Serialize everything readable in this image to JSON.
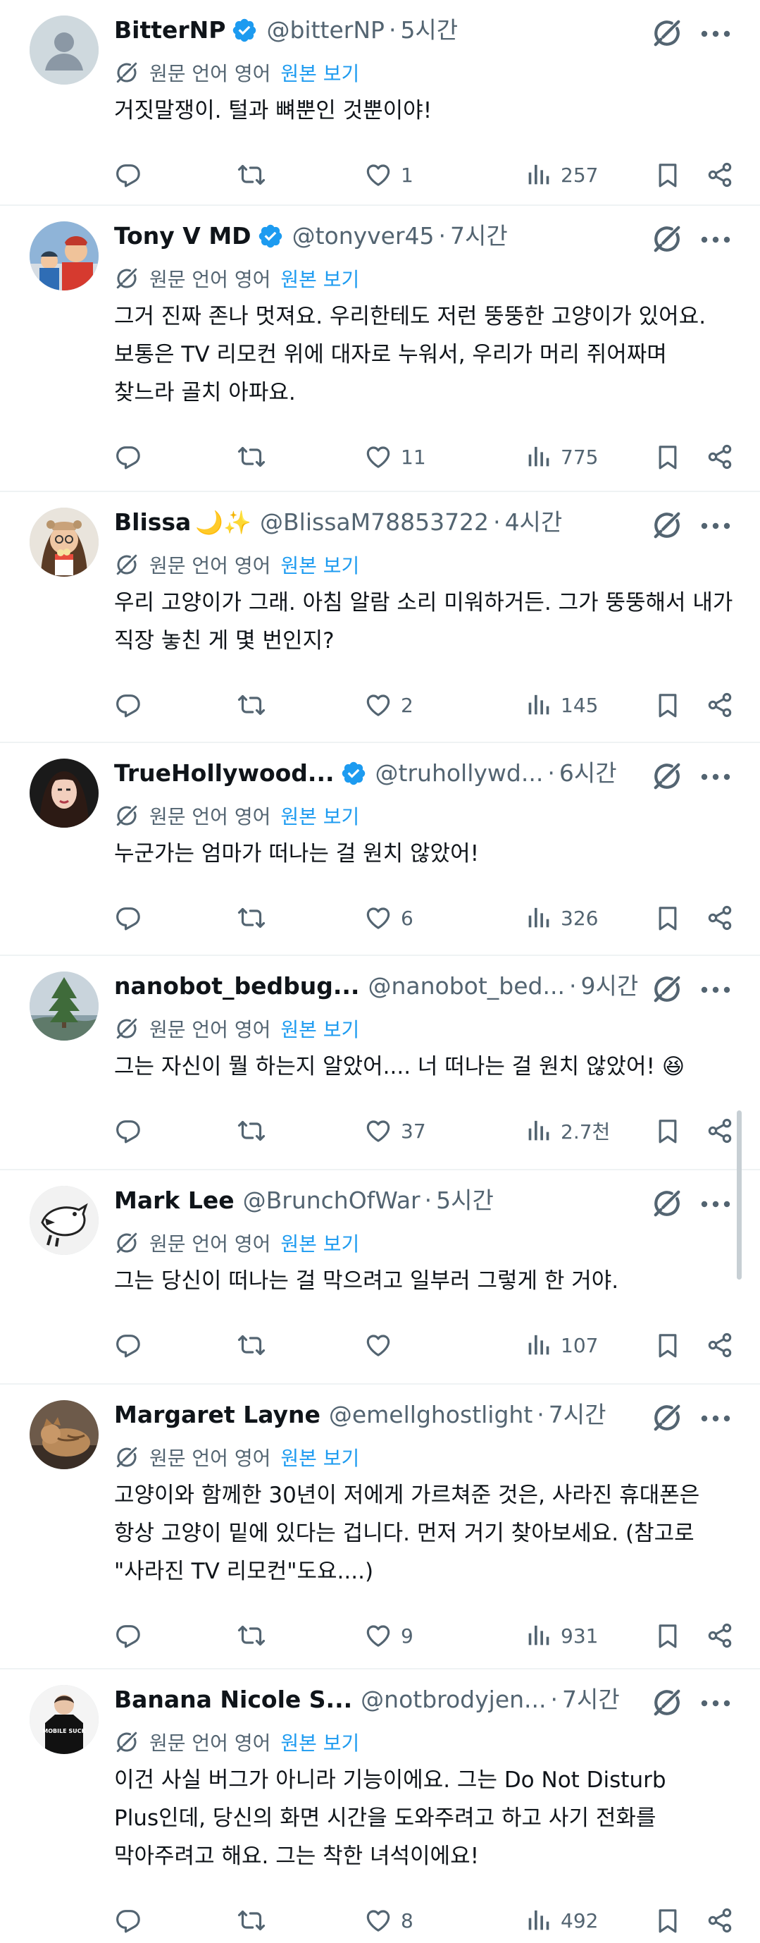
{
  "translate": {
    "label": "원문 언어 영어",
    "link": "원본 보기"
  },
  "separator": "·",
  "colors": {
    "accent": "#1d9bf0",
    "secondary": "#536471",
    "text": "#0f1419"
  },
  "tweets": [
    {
      "name": "BitterNP",
      "emoji": "",
      "verified": true,
      "handle": "@bitterNP",
      "time": "5시간",
      "text": "거짓말쟁이. 털과 뼈뿐인 것뿐이야!",
      "replies": "",
      "reposts": "",
      "likes": "1",
      "views": "257",
      "avatar": "default-avatar"
    },
    {
      "name": "Tony V MD",
      "emoji": "",
      "verified": true,
      "handle": "@tonyver45",
      "time": "7시간",
      "text": "그거 진짜 존나 멋져요. 우리한테도 저런 뚱뚱한 고양이가 있어요. 보통은 TV 리모컨 위에 대자로 누워서, 우리가 머리 쥐어짜며 찾느라 골치 아파요.",
      "replies": "",
      "reposts": "",
      "likes": "11",
      "views": "775",
      "avatar": "people-photo"
    },
    {
      "name": "Blissa",
      "emoji": "🌙✨",
      "verified": false,
      "handle": "@BlissaM78853722",
      "time": "4시간",
      "text": "우리 고양이가 그래. 아침 알람 소리 미워하거든. 그가 뚱뚱해서 내가 직장 놓친 게 몇 번인지?",
      "replies": "",
      "reposts": "",
      "likes": "2",
      "views": "145",
      "avatar": "woman-popcorn"
    },
    {
      "name": "TrueHollywood...",
      "emoji": "",
      "verified": true,
      "handle": "@truhollywd...",
      "time": "6시간",
      "text": "누군가는 엄마가 떠나는 걸 원치 않았어!",
      "replies": "",
      "reposts": "",
      "likes": "6",
      "views": "326",
      "avatar": "woman-portrait"
    },
    {
      "name": "nanobot_bedbug...",
      "emoji": "",
      "verified": false,
      "handle": "@nanobot_bed...",
      "time": "9시간",
      "text": "그는 자신이 뭘 하는지 알았어.... 너 떠나는 걸 원치 않았어! 😆",
      "replies": "",
      "reposts": "",
      "likes": "37",
      "views": "2.7천",
      "avatar": "tree-photo"
    },
    {
      "name": "Mark Lee",
      "emoji": "",
      "verified": false,
      "handle": "@BrunchOfWar",
      "time": "5시간",
      "text": "그는 당신이 떠나는 걸 막으려고 일부러 그렇게 한 거야.",
      "replies": "",
      "reposts": "",
      "likes": "",
      "views": "107",
      "avatar": "bird-drawing"
    },
    {
      "name": "Margaret Layne",
      "emoji": "",
      "verified": false,
      "handle": "@emellghostlight",
      "time": "7시간",
      "text": "고양이와 함께한 30년이 저에게 가르쳐준 것은, 사라진 휴대폰은 항상 고양이 밑에 있다는 겁니다. 먼저 거기 찾아보세요. (참고로 \"사라진 TV 리모컨\"도요....)",
      "replies": "",
      "reposts": "",
      "likes": "9",
      "views": "931",
      "avatar": "cat-photo"
    },
    {
      "name": "Banana Nicole S...",
      "emoji": "",
      "verified": false,
      "handle": "@notbrodyjen...",
      "time": "7시간",
      "text": "이건 사실 버그가 아니라 기능이에요. 그는 Do Not Disturb Plus인데, 당신의 화면 시간을 도와주려고 하고 사기 전화를 막아주려고 해요. 그는 착한 녀석이에요!",
      "replies": "",
      "reposts": "",
      "likes": "8",
      "views": "492",
      "avatar": "tshirt-photo",
      "avatar_text": "MOBILE SUCK"
    }
  ]
}
